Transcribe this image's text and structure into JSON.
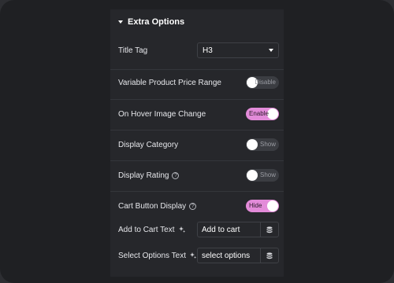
{
  "section": {
    "title": "Extra Options"
  },
  "title_tag": {
    "label": "Title Tag",
    "value": "H3"
  },
  "variable_price_range": {
    "label": "Variable Product Price Range",
    "state_text": "Disable"
  },
  "hover_image_change": {
    "label": "On Hover Image Change",
    "state_text": "Enable"
  },
  "display_category": {
    "label": "Display Category",
    "state_text": "Show"
  },
  "display_rating": {
    "label": "Display Rating",
    "state_text": "Show"
  },
  "cart_button_display": {
    "label": "Cart Button Display",
    "state_text": "Hide"
  },
  "add_to_cart_text": {
    "label": "Add to Cart Text",
    "value": "Add to cart"
  },
  "select_options_text": {
    "label": "Select Options Text",
    "value": "select options"
  },
  "colors": {
    "toggle_on": "#e38bd9",
    "toggle_off": "#3b3d42",
    "panel": "#26272b",
    "background": "#1f2023"
  }
}
